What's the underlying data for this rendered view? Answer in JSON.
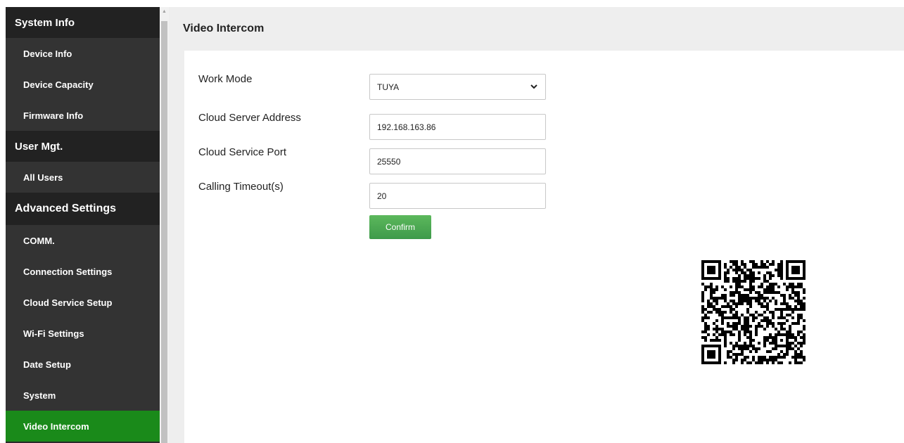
{
  "sidebar": {
    "sections": [
      {
        "header": "System Info",
        "items": [
          "Device Info",
          "Device Capacity",
          "Firmware Info"
        ]
      },
      {
        "header": "User Mgt.",
        "items": [
          "All Users"
        ]
      },
      {
        "header": "Advanced Settings",
        "items": [
          "COMM.",
          "Connection Settings",
          "Cloud Service Setup",
          "Wi-Fi Settings",
          "Date Setup",
          "System",
          "Video Intercom"
        ]
      }
    ],
    "active_item": "Video Intercom"
  },
  "page": {
    "title": "Video Intercom"
  },
  "form": {
    "work_mode": {
      "label": "Work Mode",
      "value": "TUYA"
    },
    "cloud_server_address": {
      "label": "Cloud Server Address",
      "value": "192.168.163.86"
    },
    "cloud_service_port": {
      "label": "Cloud Service Port",
      "value": "25550"
    },
    "calling_timeout": {
      "label": "Calling Timeout(s)",
      "value": "20"
    },
    "confirm_label": "Confirm"
  },
  "colors": {
    "sidebar_bg": "#2b2b2b",
    "active_item": "#1a8a1a",
    "confirm": "#4caf50"
  },
  "icons": {
    "select_arrow": "chevron-down-icon",
    "qr": "qr-code-icon"
  }
}
